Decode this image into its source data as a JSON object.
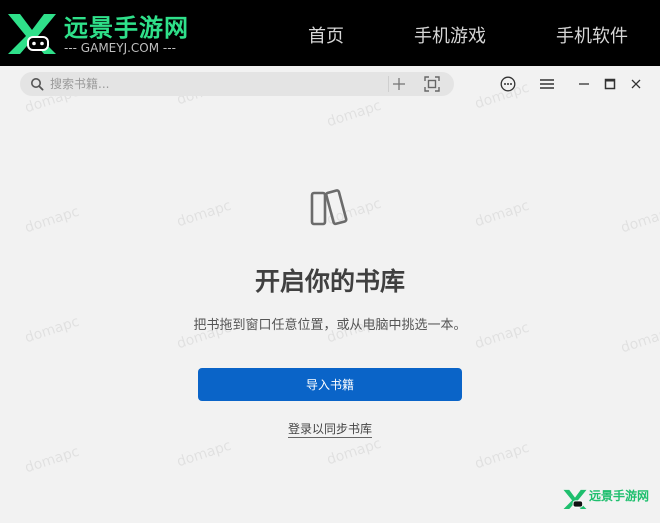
{
  "site": {
    "logo_title": "远景手游网",
    "logo_subtitle": "--- GAMEYJ.COM ---",
    "nav": [
      {
        "label": "首页"
      },
      {
        "label": "手机游戏"
      },
      {
        "label": "手机软件"
      }
    ]
  },
  "toolbar": {
    "search_placeholder": "搜索书籍...",
    "icons": [
      "search-icon",
      "plus-icon",
      "scan-icon",
      "more-icon",
      "menu-icon",
      "minimize-icon",
      "maximize-icon",
      "close-icon"
    ]
  },
  "content": {
    "heading": "开启你的书库",
    "subtext": "把书拖到窗口任意位置，或从电脑中挑选一本。",
    "import_button": "导入书籍",
    "login_link": "登录以同步书库"
  },
  "watermark": {
    "text": "domapc",
    "corner_logo_text": "远景手游网"
  },
  "colors": {
    "site_bar": "#000000",
    "brand_green": "#2fe08a",
    "accent_blue": "#0a64c8",
    "app_background": "#f2f2f2"
  }
}
